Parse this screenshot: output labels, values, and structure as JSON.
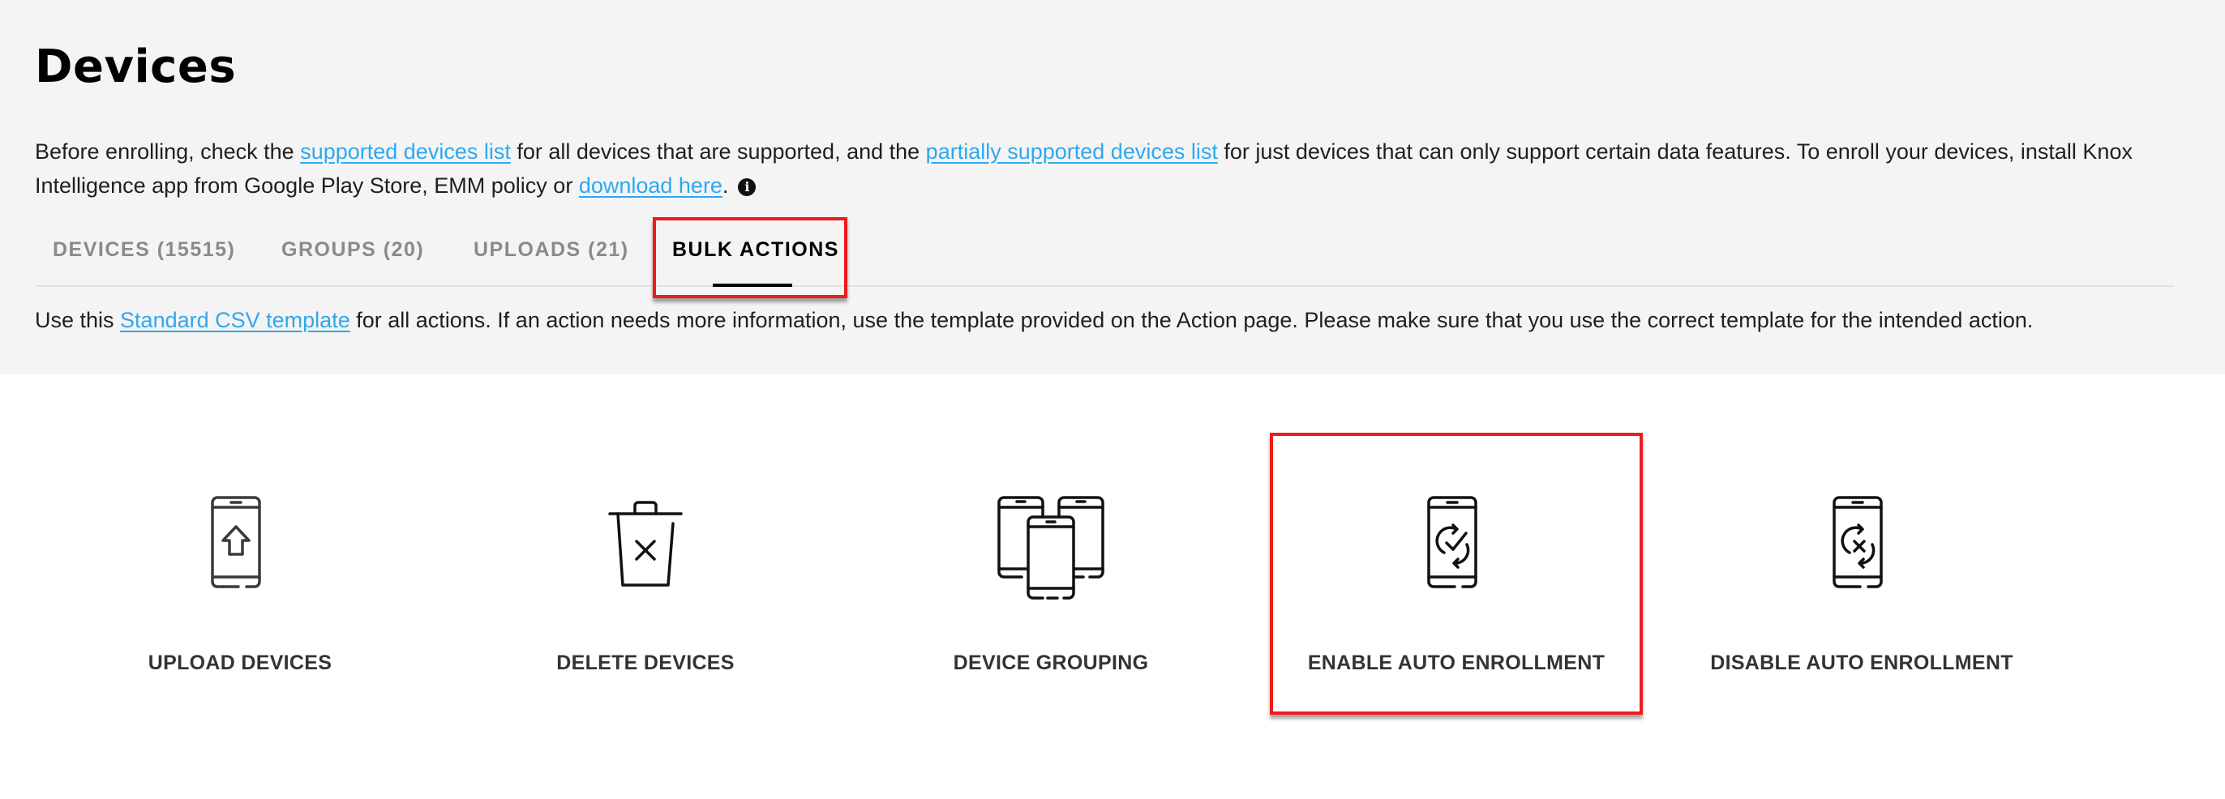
{
  "page": {
    "title": "Devices"
  },
  "intro": {
    "text_1": "Before enrolling, check the ",
    "link_supported": "supported devices list",
    "text_2": " for all devices that are supported, and the ",
    "link_partial": "partially supported devices list",
    "text_3": " for just devices that can only support certain data features. To enroll your devices, install Knox Intelligence app from Google Play Store, EMM policy or ",
    "link_download": "download here",
    "text_4": ".",
    "info_icon": "info-icon",
    "info_glyph": "i"
  },
  "tabs": [
    {
      "label": "DEVICES (15515)",
      "active": false
    },
    {
      "label": "GROUPS (20)",
      "active": false
    },
    {
      "label": "UPLOADS (21)",
      "active": false
    },
    {
      "label": "BULK ACTIONS",
      "active": true
    }
  ],
  "csv_note": {
    "text_1": "Use this ",
    "link": "Standard CSV template",
    "text_2": " for all actions. If an action needs more information, use the template provided on the Action page. Please make sure that you use the correct template for the intended action."
  },
  "actions": [
    {
      "label": "UPLOAD DEVICES",
      "icon": "phone-upload-icon"
    },
    {
      "label": "DELETE DEVICES",
      "icon": "trash-x-icon"
    },
    {
      "label": "DEVICE GROUPING",
      "icon": "phones-group-icon"
    },
    {
      "label": "ENABLE AUTO ENROLLMENT",
      "icon": "phone-sync-check-icon",
      "highlighted": true
    },
    {
      "label": "DISABLE AUTO ENROLLMENT",
      "icon": "phone-sync-x-icon"
    }
  ],
  "colors": {
    "link": "#2ea8f0",
    "highlight": "#ee1c1c",
    "header_bg": "#f4f4f4"
  }
}
